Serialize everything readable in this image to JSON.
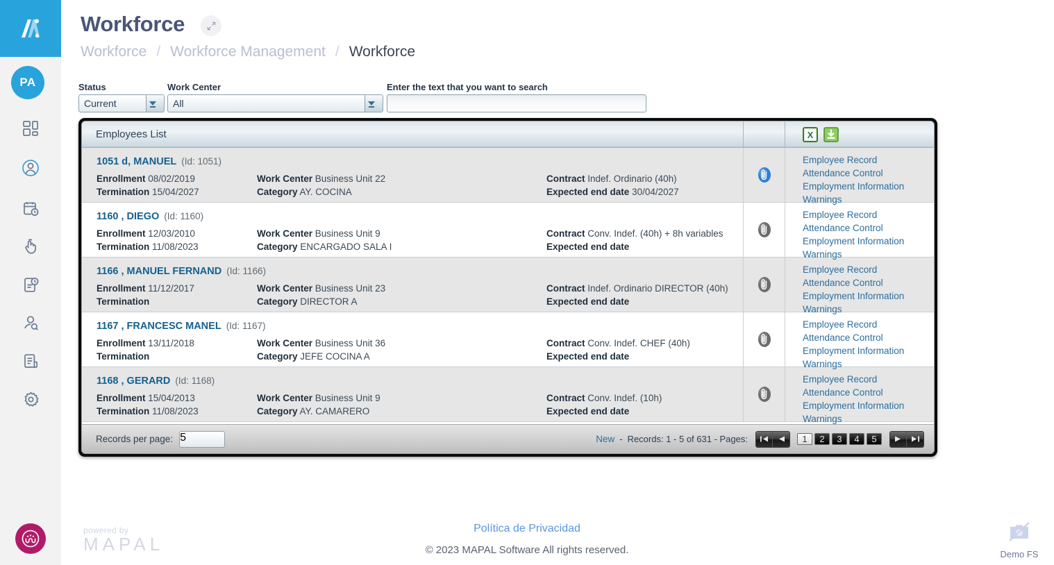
{
  "brand": {
    "logo_icon": "mapal-logo-icon",
    "user_initials": "PA"
  },
  "sidebar": {
    "items": [
      {
        "name": "dashboard",
        "icon": "dashboard-grid-icon"
      },
      {
        "name": "profile",
        "icon": "user-circle-icon"
      },
      {
        "name": "schedule",
        "icon": "calendar-clock-icon"
      },
      {
        "name": "clocking",
        "icon": "hand-click-icon"
      },
      {
        "name": "time-reports",
        "icon": "document-clock-icon"
      },
      {
        "name": "employee-search",
        "icon": "user-search-icon"
      },
      {
        "name": "documents",
        "icon": "document-lines-icon"
      },
      {
        "name": "settings",
        "icon": "gear-icon"
      }
    ],
    "bottom_logo_icon": "people-circle-logo-icon"
  },
  "header": {
    "title": "Workforce",
    "expand_icon": "expand-arrows-icon",
    "breadcrumb": [
      "Workforce",
      "Workforce Management",
      "Workforce"
    ],
    "breadcrumb_separator": "/"
  },
  "filters": {
    "status": {
      "label": "Status",
      "value": "Current"
    },
    "work_center": {
      "label": "Work Center",
      "value": "All"
    },
    "search": {
      "label": "Enter the text that you want to search",
      "value": "",
      "placeholder": ""
    }
  },
  "grid": {
    "title": "Employees List",
    "tools": [
      {
        "name": "export-excel",
        "icon": "excel-icon"
      },
      {
        "name": "download",
        "icon": "download-icon"
      }
    ],
    "labels": {
      "enrollment": "Enrollment",
      "termination": "Termination",
      "work_center": "Work Center",
      "category": "Category",
      "contract": "Contract",
      "expected_end_date": "Expected end date"
    },
    "link_labels": [
      "Employee Record",
      "Attendance Control",
      "Employment Information",
      "Warnings"
    ],
    "attachment_icon": "paperclip-icon",
    "rows": [
      {
        "name": "1051 d, MANUEL",
        "id_text": "(Id: 1051)",
        "enrollment": "08/02/2019",
        "termination": "15/04/2027",
        "work_center": "Business Unit 22",
        "category": "AY. COCINA",
        "contract": "Indef. Ordinario (40h)",
        "expected_end_date": "30/04/2027",
        "has_attachment": true
      },
      {
        "name": "1160 , DIEGO",
        "id_text": "(Id: 1160)",
        "enrollment": "12/03/2010",
        "termination": "11/08/2023",
        "work_center": "Business Unit 9",
        "category": "ENCARGADO SALA I",
        "contract": "Conv. Indef. (40h) + 8h variables",
        "expected_end_date": "",
        "has_attachment": false
      },
      {
        "name": "1166 , MANUEL FERNAND",
        "id_text": "(Id: 1166)",
        "enrollment": "11/12/2017",
        "termination": "",
        "work_center": "Business Unit 23",
        "category": "DIRECTOR A",
        "contract": "Indef. Ordinario DIRECTOR (40h)",
        "expected_end_date": "",
        "has_attachment": false
      },
      {
        "name": "1167 , FRANCESC MANEL",
        "id_text": "(Id: 1167)",
        "enrollment": "13/11/2018",
        "termination": "",
        "work_center": "Business Unit 36",
        "category": "JEFE COCINA A",
        "contract": "Conv. Indef. CHEF (40h)",
        "expected_end_date": "",
        "has_attachment": false
      },
      {
        "name": "1168 , GERARD",
        "id_text": "(Id: 1168)",
        "enrollment": "15/04/2013",
        "termination": "11/08/2023",
        "work_center": "Business Unit 9",
        "category": "AY. CAMARERO",
        "contract": "Conv. Indef. (10h)",
        "expected_end_date": "",
        "has_attachment": false
      }
    ]
  },
  "pagination": {
    "records_per_page_label": "Records per page:",
    "records_per_page_value": "5",
    "new_label": "New",
    "separator": "-",
    "records_summary": "Records: 1 - 5 of 631 - Pages:",
    "pages": [
      "1",
      "2",
      "3",
      "4",
      "5"
    ],
    "active_page": "1",
    "first_icon": "first-page-icon",
    "prev_icon": "prev-page-icon",
    "next_icon": "next-page-icon",
    "last_icon": "last-page-icon"
  },
  "footer": {
    "powered_by": "powered by",
    "powered_brand": "MAPAL",
    "privacy_link": "Política de Privacidad",
    "copyright": "© 2023 MAPAL Software All rights reserved.",
    "demo_label": "Demo FS",
    "demo_icon": "no-image-placeholder-icon"
  },
  "colors": {
    "brand_blue": "#29a3dc",
    "title_navy": "#4a5578",
    "link_blue": "#2d6e9e",
    "badge_magenta": "#b01b69"
  }
}
